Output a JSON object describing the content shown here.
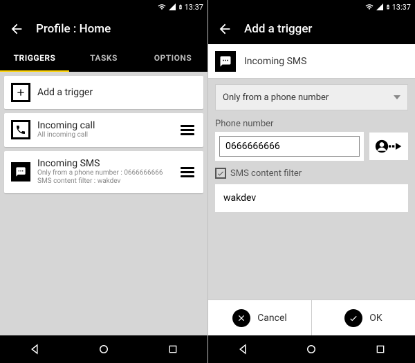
{
  "statusbar": {
    "time": "13:37"
  },
  "left": {
    "toolbar": {
      "title": "Profile : Home"
    },
    "tabs": [
      {
        "label": "TRIGGERS",
        "active": true
      },
      {
        "label": "TASKS",
        "active": false
      },
      {
        "label": "OPTIONS",
        "active": false
      }
    ],
    "addTrigger": {
      "label": "Add a trigger"
    },
    "items": [
      {
        "icon": "phone-icon",
        "label": "Incoming call",
        "sub": "All incoming call"
      },
      {
        "icon": "sms-icon",
        "label": "Incoming SMS",
        "sub": "Only from a phone number : 0666666666\nSMS content filter : wakdev"
      }
    ]
  },
  "right": {
    "toolbar": {
      "title": "Add a trigger"
    },
    "header": {
      "label": "Incoming SMS"
    },
    "filterMode": {
      "selected": "Only from a phone number"
    },
    "phoneLabel": "Phone number",
    "phoneValue": "0666666666",
    "smsFilter": {
      "label": "SMS content filter",
      "checked": true
    },
    "smsFilterValue": "wakdev",
    "buttons": {
      "cancel": "Cancel",
      "ok": "OK"
    }
  }
}
